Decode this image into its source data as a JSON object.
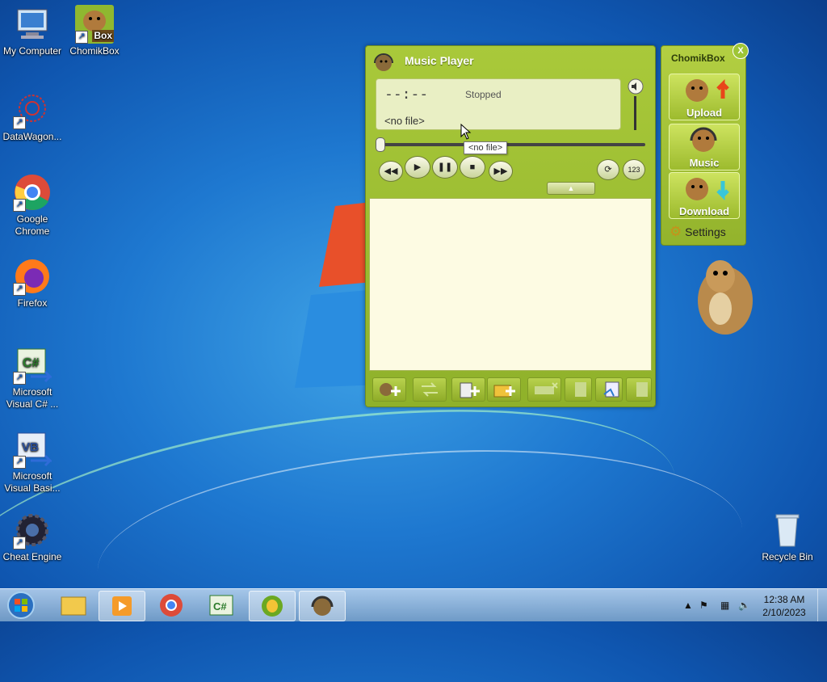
{
  "desktop": {
    "icons": [
      {
        "label": "My Computer"
      },
      {
        "label": "ChomikBox",
        "badge": "Box"
      },
      {
        "label": "DataWagon..."
      },
      {
        "label": "Google Chrome"
      },
      {
        "label": "Firefox"
      },
      {
        "label": "Microsoft Visual C# ..."
      },
      {
        "label": "Microsoft Visual Basi..."
      },
      {
        "label": "Cheat Engine"
      },
      {
        "label": "Recycle Bin"
      }
    ]
  },
  "music_player": {
    "title": "Music Player",
    "time": "--:--",
    "status": "Stopped",
    "file": "<no file>",
    "tooltip": "<no file>"
  },
  "chomikbox": {
    "title": "ChomikBox",
    "close": "X",
    "buttons": {
      "upload": "Upload",
      "music": "Music",
      "download": "Download"
    },
    "settings": "Settings"
  },
  "taskbar": {
    "time": "12:38 AM",
    "date": "2/10/2023"
  }
}
